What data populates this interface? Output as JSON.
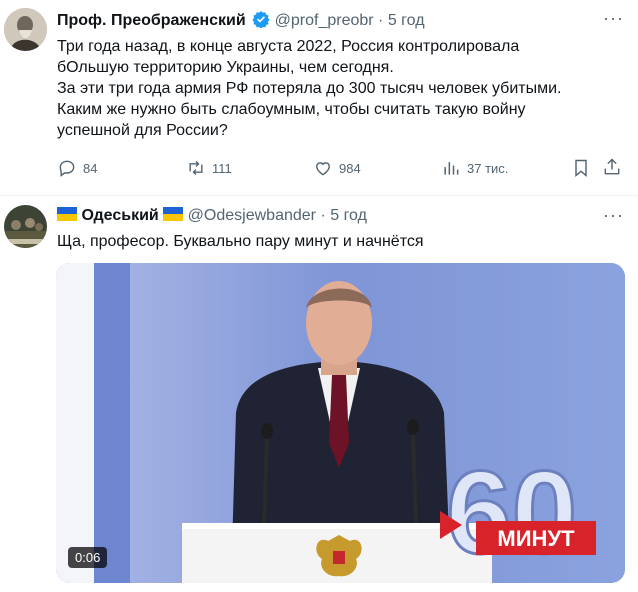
{
  "tweet1": {
    "author": "Проф. Преображенский",
    "handle": "@prof_preobr",
    "separator": "·",
    "time": "5 год",
    "lines": [
      "Три года назад, в конце августа 2022, Россия контролировала",
      "бОльшую территорию Украины, чем сегодня.",
      "За эти три года армия РФ потеряла до 300 тысяч человек убитыми.",
      "Каким же нужно быть слабоумным, чтобы считать такую войну",
      "успешной для России?"
    ],
    "replies": "84",
    "reposts": "111",
    "likes": "984",
    "views": "37 тис.",
    "more": "···"
  },
  "tweet2": {
    "author": "Одеський",
    "handle": "@Odesjewbander",
    "separator": "·",
    "time": "5 год",
    "text": "Ща, професор. Буквально пару минут и начнётся",
    "more": "···",
    "video": {
      "duration": "0:06",
      "overlay_number": "60",
      "overlay_label": "МИНУТ"
    }
  },
  "colors": {
    "verified": "#1d9bf0",
    "muted": "#536471",
    "video_bg": "#8fa4dc",
    "minut_red": "#d8232a"
  }
}
